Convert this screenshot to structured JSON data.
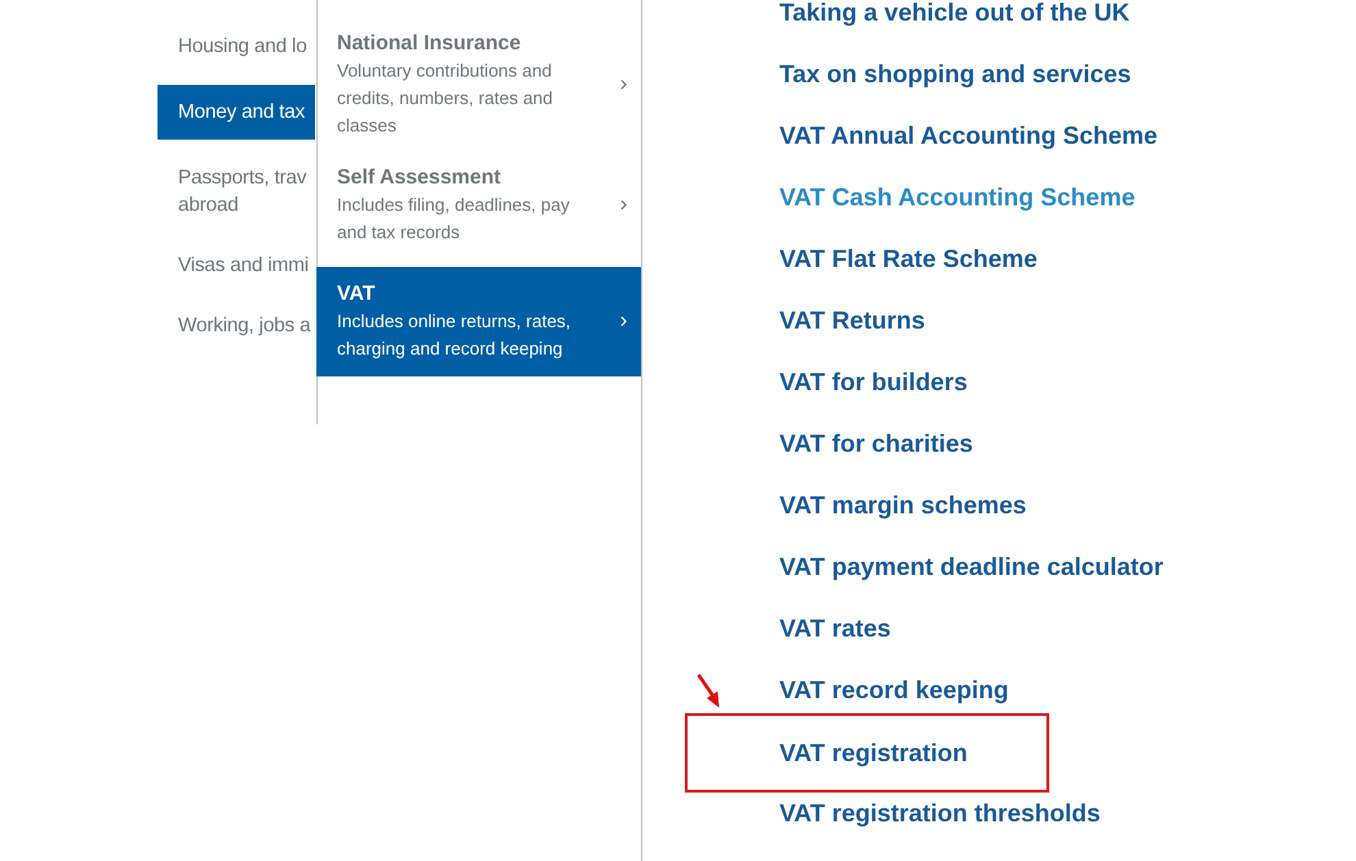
{
  "categories": [
    {
      "lines": [
        "Housing and lo"
      ],
      "selected": false
    },
    {
      "lines": [
        "Money and tax"
      ],
      "selected": true
    },
    {
      "lines": [
        "Passports, trav",
        "abroad"
      ],
      "selected": false
    },
    {
      "lines": [
        "Visas and immi"
      ],
      "selected": false
    },
    {
      "lines": [
        "Working, jobs a"
      ],
      "selected": false
    }
  ],
  "subcategories": [
    {
      "title": "National Insurance",
      "description": "Voluntary contributions and credits, numbers, rates and classes",
      "chevron": "›",
      "selected": false
    },
    {
      "title": "Self Assessment",
      "description": "Includes filing, deadlines, pay and tax records",
      "chevron": "›",
      "selected": false
    },
    {
      "title": "VAT",
      "description": "Includes online returns, rates, charging and record keeping",
      "chevron": "›",
      "selected": true
    }
  ],
  "links": [
    {
      "label": "Taking a vehicle out of the UK",
      "hovered": false,
      "boxed": false
    },
    {
      "label": "Tax on shopping and services",
      "hovered": false,
      "boxed": false
    },
    {
      "label": "VAT Annual Accounting Scheme",
      "hovered": false,
      "boxed": false
    },
    {
      "label": "VAT Cash Accounting Scheme",
      "hovered": true,
      "boxed": false
    },
    {
      "label": "VAT Flat Rate Scheme",
      "hovered": false,
      "boxed": false
    },
    {
      "label": "VAT Returns",
      "hovered": false,
      "boxed": false
    },
    {
      "label": "VAT for builders",
      "hovered": false,
      "boxed": false
    },
    {
      "label": "VAT for charities",
      "hovered": false,
      "boxed": false
    },
    {
      "label": "VAT margin schemes",
      "hovered": false,
      "boxed": false
    },
    {
      "label": "VAT payment deadline calculator",
      "hovered": false,
      "boxed": false
    },
    {
      "label": "VAT rates",
      "hovered": false,
      "boxed": false
    },
    {
      "label": "VAT record keeping",
      "hovered": false,
      "boxed": false
    },
    {
      "label": "VAT registration",
      "hovered": false,
      "boxed": true
    },
    {
      "label": "VAT registration thresholds",
      "hovered": false,
      "boxed": false
    }
  ]
}
